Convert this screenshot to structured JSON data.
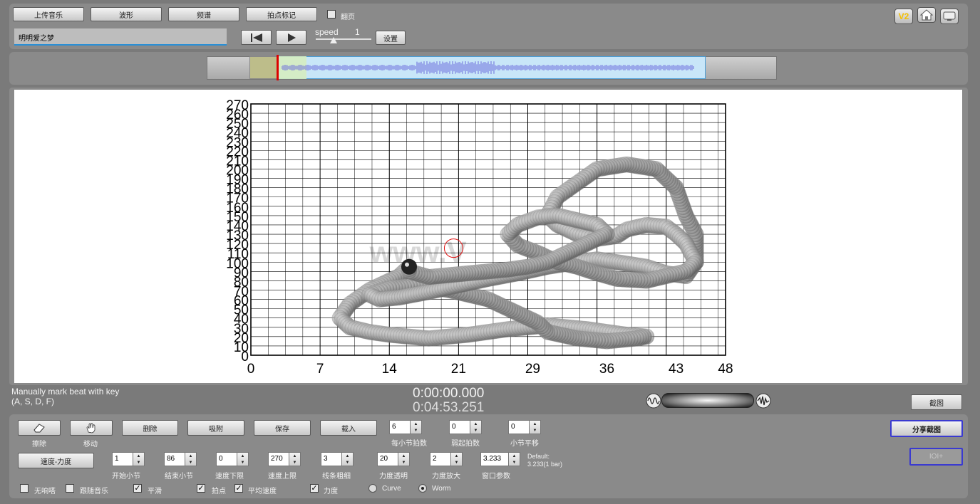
{
  "toolbar": {
    "upload_label": "上传音乐",
    "waveform_label": "波形",
    "spectrum_label": "频谱",
    "beat_mark_label": "拍点标记",
    "page_turn_label": "翻页",
    "song_name": "明明爱之梦",
    "speed_label": "speed",
    "speed_value": "1",
    "set_label": "设置",
    "v2_label": "V2"
  },
  "chart": {
    "watermark": "www.V"
  },
  "chart_data": {
    "type": "line",
    "title": "",
    "xlabel": "",
    "ylabel": "",
    "xlim": [
      0,
      48
    ],
    "ylim": [
      0,
      270
    ],
    "x_ticks": [
      "0",
      "7",
      "14",
      "21",
      "29",
      "36",
      "43",
      "48"
    ],
    "y_ticks": [
      "0",
      "10",
      "20",
      "30",
      "40",
      "50",
      "60",
      "70",
      "80",
      "90",
      "100",
      "110",
      "120",
      "130",
      "140",
      "150",
      "160",
      "170",
      "180",
      "190",
      "200",
      "210",
      "220",
      "230",
      "240",
      "250",
      "260",
      "270"
    ],
    "grid": true,
    "series": [
      {
        "x": [
          16,
          15,
          12,
          10,
          9,
          10,
          12,
          14,
          16,
          18,
          20,
          22,
          24,
          26,
          28,
          30,
          32,
          34,
          36,
          38,
          40,
          39,
          36,
          33,
          30,
          29,
          27,
          24,
          20,
          17,
          14,
          12,
          13,
          15,
          18,
          21,
          24,
          27,
          30,
          33,
          35,
          37,
          40,
          42,
          44,
          45,
          45,
          44,
          43,
          41,
          38,
          35,
          33,
          31,
          30,
          31,
          33,
          35,
          37,
          38,
          40,
          42,
          43,
          44,
          45,
          44,
          42,
          40,
          37,
          35,
          33,
          31,
          29,
          27,
          26,
          27,
          29,
          31,
          33,
          35,
          36,
          34,
          32,
          30,
          28,
          26,
          24,
          22,
          20,
          18,
          16,
          16
        ],
        "y": [
          95,
          85,
          70,
          55,
          40,
          30,
          25,
          22,
          20,
          18,
          20,
          22,
          25,
          28,
          30,
          32,
          30,
          28,
          25,
          22,
          20,
          18,
          15,
          18,
          25,
          35,
          45,
          60,
          70,
          75,
          72,
          65,
          60,
          62,
          68,
          75,
          82,
          88,
          95,
          100,
          103,
          100,
          95,
          88,
          85,
          100,
          130,
          150,
          180,
          200,
          205,
          200,
          185,
          170,
          150,
          140,
          130,
          125,
          128,
          135,
          140,
          138,
          130,
          120,
          100,
          90,
          85,
          80,
          82,
          88,
          95,
          100,
          110,
          118,
          130,
          140,
          148,
          150,
          145,
          140,
          130,
          120,
          110,
          100,
          95,
          92,
          90,
          88,
          86,
          84,
          90,
          95
        ]
      }
    ]
  },
  "waveform": {},
  "status": {
    "hint_line1": "Manually mark beat with key",
    "hint_line2": "(A, S, D, F)",
    "time_current": "0:00:00.000",
    "time_total": "0:04:53.251",
    "screenshot_label": "截图"
  },
  "controls": {
    "erase_label": "擦除",
    "move_label": "移动",
    "delete_label": "删除",
    "snap_label": "吸附",
    "save_label": "保存",
    "load_label": "载入",
    "beats_per_bar_label": "每小节拍数",
    "beats_per_bar_value": "6",
    "pickup_label": "弱起拍数",
    "pickup_value": "0",
    "bar_shift_label": "小节平移",
    "bar_shift_value": "0",
    "share_label": "分享截图",
    "ioi_label": "IOI+",
    "tempo_dynamics_label": "速度-力度",
    "start_bar_label": "开始小节",
    "start_bar_value": "1",
    "end_bar_label": "结束小节",
    "end_bar_value": "86",
    "tempo_min_label": "速度下限",
    "tempo_min_value": "0",
    "tempo_max_label": "速度上限",
    "tempo_max_value": "270",
    "line_width_label": "线条粗细",
    "line_width_value": "3",
    "dyn_opacity_label": "力度透明",
    "dyn_opacity_value": "20",
    "dyn_zoom_label": "力度放大",
    "dyn_zoom_value": "2",
    "window_label": "窗口参数",
    "window_value": "3.233",
    "default_line1": "Default:",
    "default_line2": "3.233(1 bar)",
    "metronome_label": "无响嗒",
    "follow_music_label": "跟随音乐",
    "smooth_label": "平滑",
    "beat_point_label": "拍点",
    "avg_tempo_label": "平均速度",
    "dynamics_label": "力度",
    "curve_label": "Curve",
    "worm_label": "Worm"
  }
}
